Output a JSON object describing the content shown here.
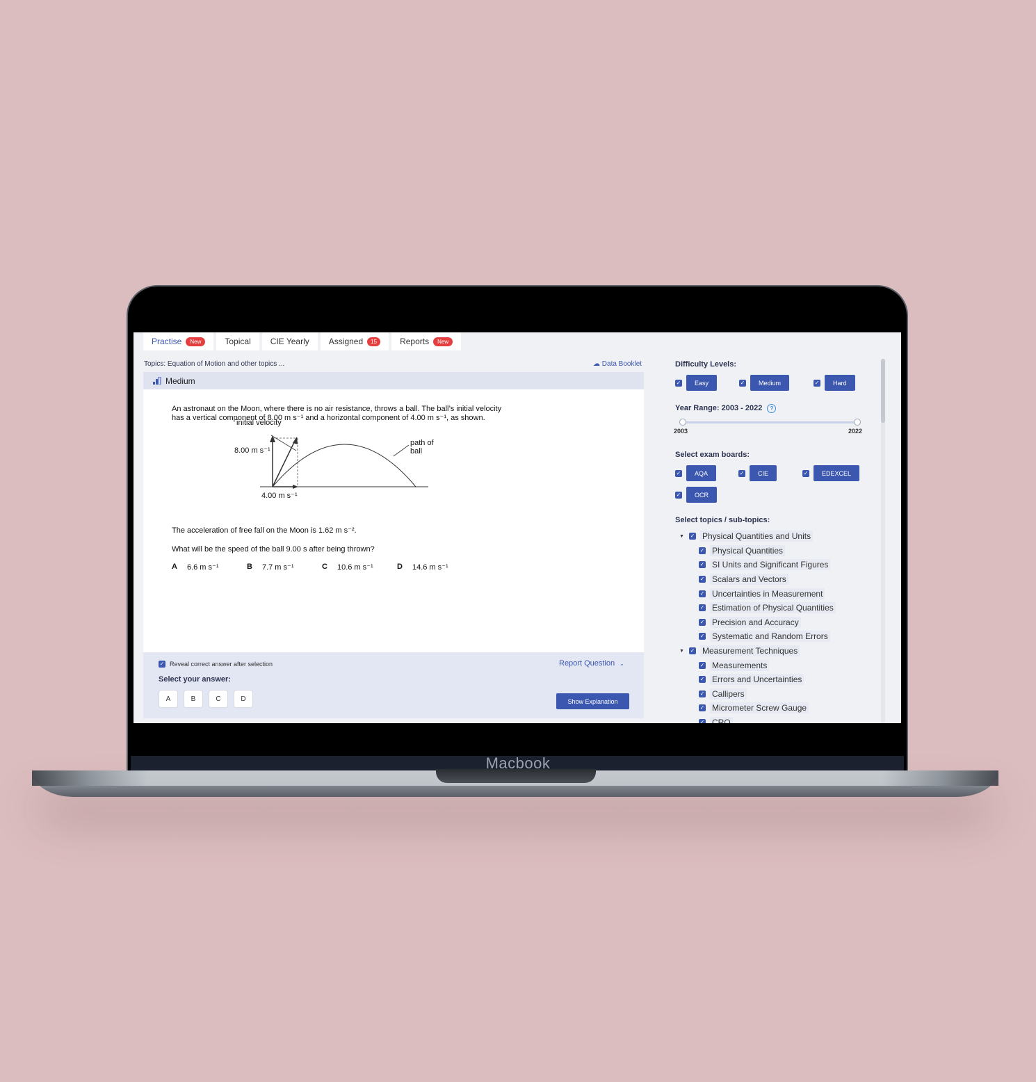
{
  "device": {
    "label": "Macbook"
  },
  "tabs": [
    {
      "label": "Practise",
      "badge": "New"
    },
    {
      "label": "Topical",
      "badge": ""
    },
    {
      "label": "CIE Yearly",
      "badge": ""
    },
    {
      "label": "Assigned",
      "badge": "15"
    },
    {
      "label": "Reports",
      "badge": "New"
    }
  ],
  "question": {
    "topics": "Topics: Equation of Motion and other topics ...",
    "data_booklet": "Data Booklet",
    "difficulty": "Medium",
    "intro_line1": "An astronaut on the Moon, where there is no air resistance, throws a ball. The ball’s initial velocity",
    "intro_line2": "has a vertical component of 8.00 m s⁻¹ and a horizontal component of 4.00 m s⁻¹, as shown.",
    "diagram": {
      "initial_velocity": "initial velocity",
      "vertical": "8.00 m s⁻¹",
      "path": "path of ball",
      "horizontal": "4.00 m s⁻¹"
    },
    "acceleration": "The acceleration of free fall on the Moon is 1.62 m s⁻².",
    "prompt": "What will be the speed of the ball 9.00 s after being thrown?",
    "options": [
      {
        "key": "A",
        "value": "6.6 m s⁻¹"
      },
      {
        "key": "B",
        "value": "7.7 m s⁻¹"
      },
      {
        "key": "C",
        "value": "10.6 m s⁻¹"
      },
      {
        "key": "D",
        "value": "14.6 m s⁻¹"
      }
    ]
  },
  "footer": {
    "reveal": "Reveal correct answer after selection",
    "report": "Report Question",
    "select_answer": "Select your answer:",
    "answers": [
      "A",
      "B",
      "C",
      "D"
    ],
    "explain": "Show Explanation"
  },
  "sidebar": {
    "difficulty_title": "Difficulty Levels:",
    "difficulty": [
      "Easy",
      "Medium",
      "Hard"
    ],
    "year_range_title": "Year Range: 2003 - 2022",
    "year_min": "2003",
    "year_max": "2022",
    "boards_title": "Select exam boards:",
    "boards": [
      "AQA",
      "CIE",
      "EDEXCEL",
      "OCR"
    ],
    "topics_title": "Select topics / sub-topics:",
    "topics": [
      {
        "label": "Physical Quantities and Units",
        "level": 0
      },
      {
        "label": "Physical Quantities",
        "level": 1
      },
      {
        "label": "SI Units and Significant Figures",
        "level": 1
      },
      {
        "label": "Scalars and Vectors",
        "level": 1
      },
      {
        "label": "Uncertainties in Measurement",
        "level": 1
      },
      {
        "label": "Estimation of Physical Quantities",
        "level": 1
      },
      {
        "label": "Precision and Accuracy",
        "level": 1
      },
      {
        "label": "Systematic and Random Errors",
        "level": 1
      },
      {
        "label": "Measurement Techniques",
        "level": 0
      },
      {
        "label": "Measurements",
        "level": 1
      },
      {
        "label": "Errors and Uncertainties",
        "level": 1
      },
      {
        "label": "Callipers",
        "level": 1
      },
      {
        "label": "Micrometer Screw Gauge",
        "level": 1
      },
      {
        "label": "CRO",
        "level": 1
      }
    ]
  },
  "colors": {
    "accent": "#3b57b0",
    "badge": "#e53e3e",
    "background": "#dcbdbf"
  }
}
